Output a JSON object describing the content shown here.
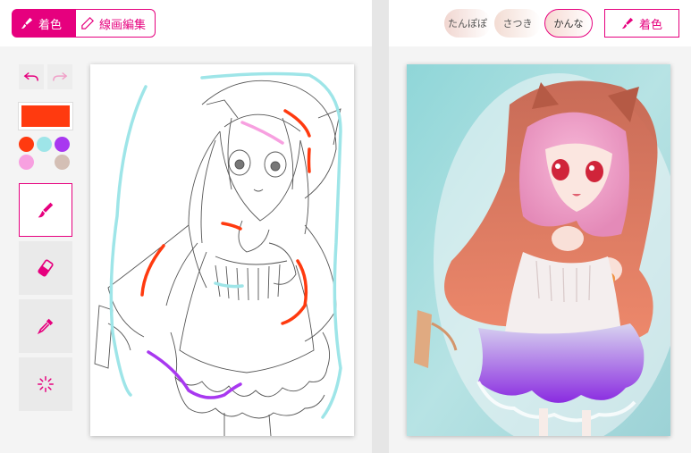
{
  "left_pane": {
    "mode_tabs": {
      "color_label": "着色",
      "lineart_label": "線画編集",
      "active": "color"
    },
    "current_color": "#ff3a0f",
    "palette": [
      {
        "name": "red-orange",
        "color": "#ff3a0f"
      },
      {
        "name": "light-cyan",
        "color": "#9ee5e8"
      },
      {
        "name": "purple",
        "color": "#a838f0"
      },
      {
        "name": "pink",
        "color": "#f7a0e0"
      },
      {
        "name": "beige",
        "color": "#d4bfb5"
      }
    ],
    "tools": [
      {
        "name": "brush-tool",
        "icon": "brush-icon",
        "active": true
      },
      {
        "name": "eraser-tool",
        "icon": "eraser-icon",
        "active": false
      },
      {
        "name": "eyedropper-tool",
        "icon": "eyedropper-icon",
        "active": false
      },
      {
        "name": "hint-tool",
        "icon": "sparkle-icon",
        "active": false
      }
    ]
  },
  "right_pane": {
    "styles": [
      {
        "label": "たんぽぽ",
        "active": false,
        "tint": "#f1d6d0"
      },
      {
        "label": "さつき",
        "active": false,
        "tint": "#f3dcd3"
      },
      {
        "label": "かんな",
        "active": true,
        "tint": "#f7d9d2"
      }
    ],
    "colorize_label": "着色"
  },
  "colors": {
    "accent": "#e6007e",
    "hint_cyan": "#9ee5e8",
    "hint_red": "#ff3a0f",
    "hint_purple": "#a838f0",
    "hint_pink": "#f7a0e0"
  }
}
